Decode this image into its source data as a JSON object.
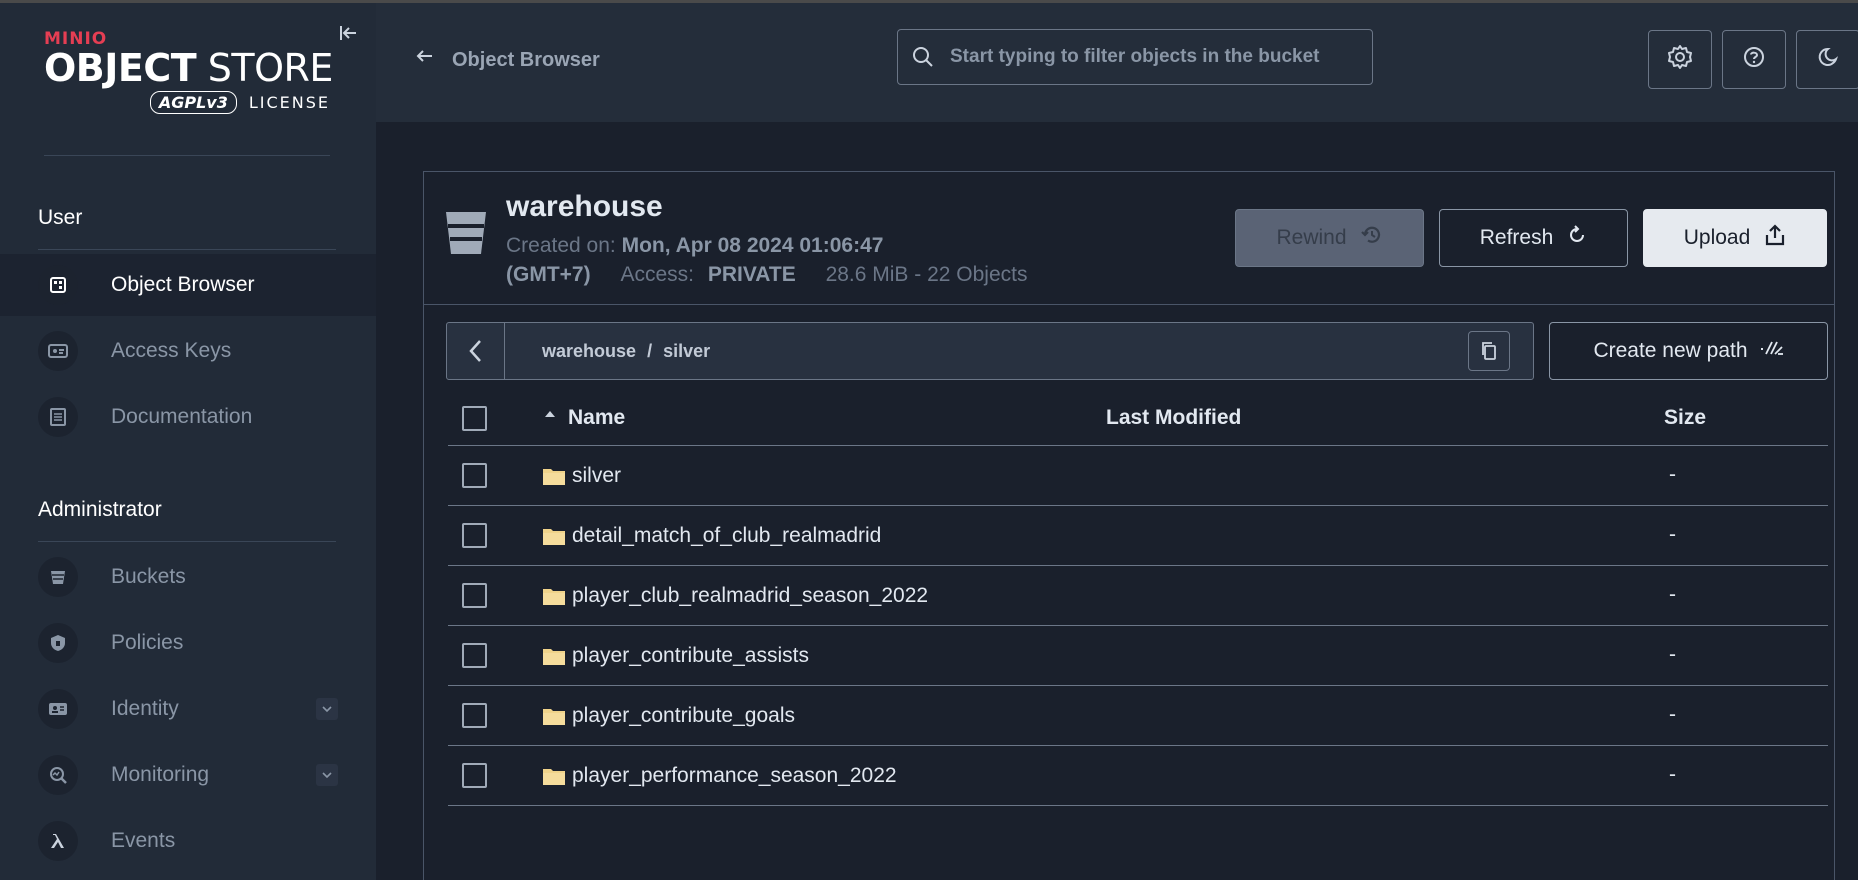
{
  "brand": {
    "minio": "MINIO",
    "object": "OBJECT",
    "store": "STORE",
    "agpl": "AGPLv3",
    "license": "LICENSE"
  },
  "sidebar": {
    "user_section": "User",
    "admin_section": "Administrator",
    "user_items": [
      {
        "label": "Object Browser",
        "icon": "object-browser-icon",
        "active": true
      },
      {
        "label": "Access Keys",
        "icon": "access-keys-icon"
      },
      {
        "label": "Documentation",
        "icon": "documentation-icon"
      }
    ],
    "admin_items": [
      {
        "label": "Buckets",
        "icon": "bucket-icon"
      },
      {
        "label": "Policies",
        "icon": "policy-icon"
      },
      {
        "label": "Identity",
        "icon": "identity-icon",
        "expandable": true
      },
      {
        "label": "Monitoring",
        "icon": "monitoring-icon",
        "expandable": true
      },
      {
        "label": "Events",
        "icon": "lambda-icon"
      }
    ]
  },
  "header": {
    "title": "Object Browser",
    "search_placeholder": "Start typing to filter objects in the bucket"
  },
  "bucket": {
    "name": "warehouse",
    "created_label": "Created on:",
    "created_value": "Mon, Apr 08 2024 01:06:47",
    "timezone": "(GMT+7)",
    "access_label": "Access:",
    "access_value": "PRIVATE",
    "usage": "28.6 MiB - 22 Objects"
  },
  "actions": {
    "rewind": "Rewind",
    "refresh": "Refresh",
    "upload": "Upload",
    "create_path": "Create new path"
  },
  "path": {
    "bucket": "warehouse",
    "separator": "/",
    "folder": "silver"
  },
  "table": {
    "columns": {
      "name": "Name",
      "modified": "Last Modified",
      "size": "Size"
    },
    "rows": [
      {
        "name": "silver",
        "modified": "",
        "size": "-"
      },
      {
        "name": "detail_match_of_club_realmadrid",
        "modified": "",
        "size": "-"
      },
      {
        "name": "player_club_realmadrid_season_2022",
        "modified": "",
        "size": "-"
      },
      {
        "name": "player_contribute_assists",
        "modified": "",
        "size": "-"
      },
      {
        "name": "player_contribute_goals",
        "modified": "",
        "size": "-"
      },
      {
        "name": "player_performance_season_2022",
        "modified": "",
        "size": "-"
      }
    ]
  },
  "colors": {
    "sidebar_bg": "#222b38",
    "header_bg": "#242d3a",
    "main_bg": "#1a202c",
    "brand_red": "#e53e53",
    "folder": "#f0d38a"
  }
}
